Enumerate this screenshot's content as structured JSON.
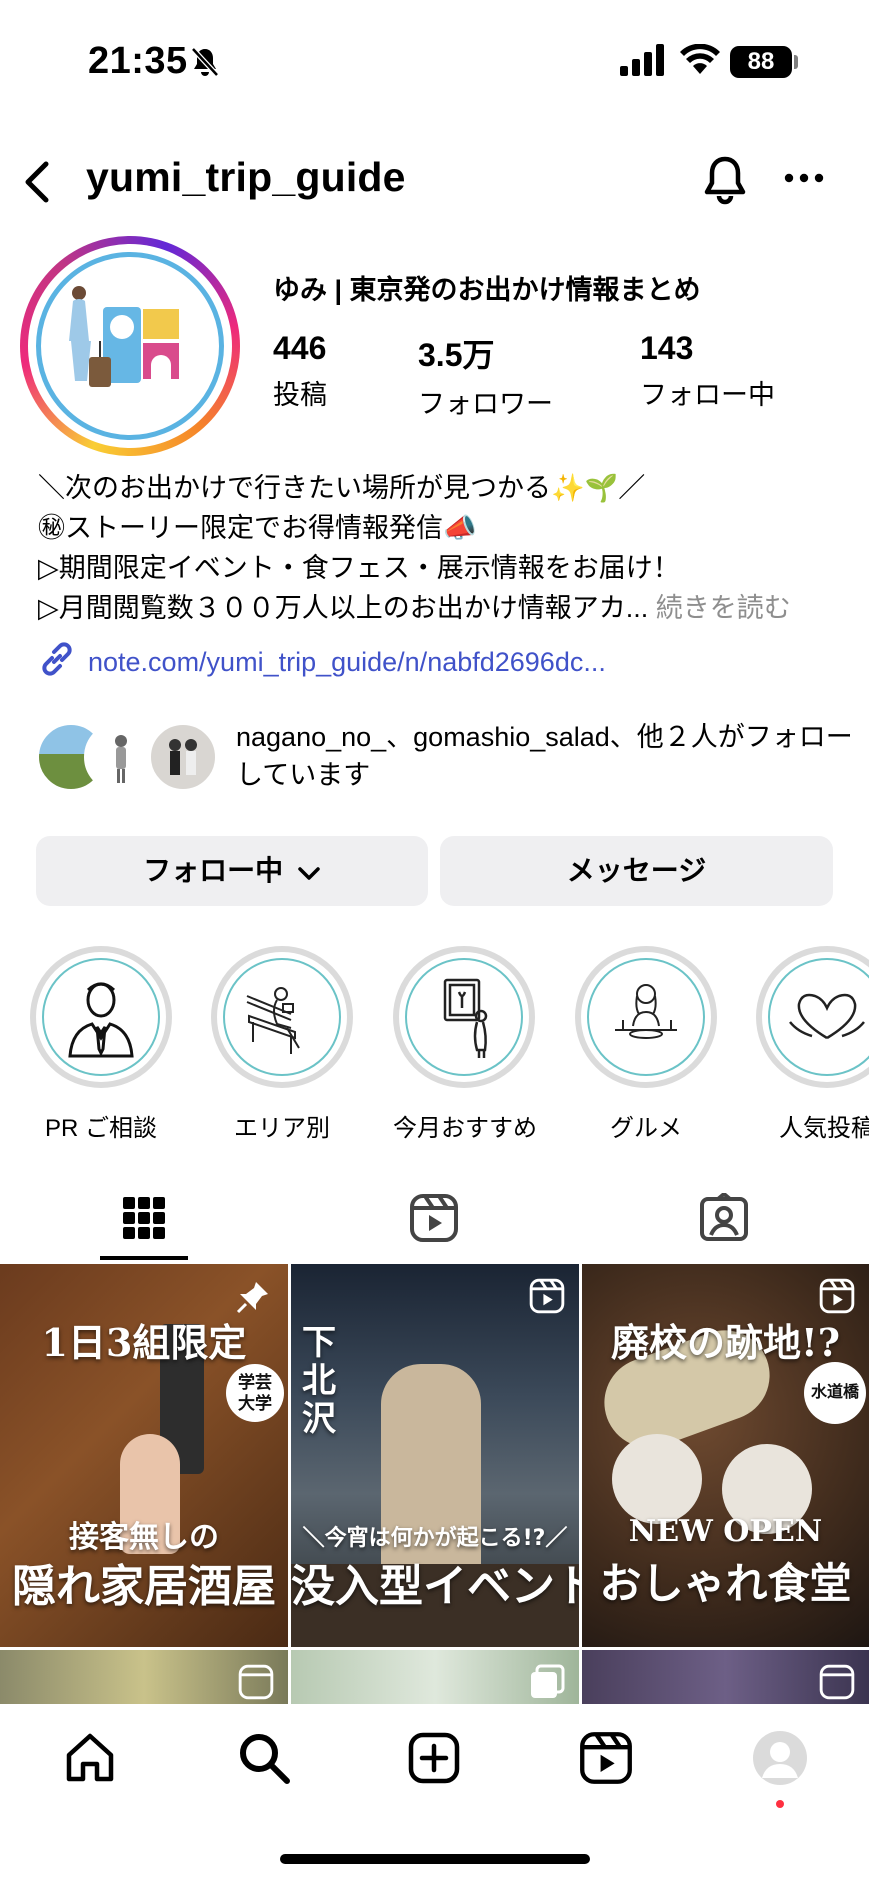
{
  "status": {
    "time": "21:35",
    "battery": "88"
  },
  "header": {
    "username": "yumi_trip_guide"
  },
  "profile": {
    "display_name": "ゆみ | 東京発のお出かけ情報まとめ",
    "stats": [
      {
        "value": "446",
        "label": "投稿"
      },
      {
        "value": "3.5万",
        "label": "フォロワー"
      },
      {
        "value": "143",
        "label": "フォロー中"
      }
    ],
    "bio_lines": [
      "＼次のお出かけで行きたい場所が見つかる✨🌱／",
      "㊙ストーリー限定でお得情報発信📣",
      "▷期間限定イベント・食フェス・展示情報をお届け！",
      "▷月間閲覧数３００万人以上のお出かけ情報アカ..."
    ],
    "bio_more": "続きを読む",
    "link": "note.com/yumi_trip_guide/n/nabfd2696dc...",
    "mutual_text": "nagano_no_、gomashio_salad、他２人がフォローしています"
  },
  "buttons": {
    "following": "フォロー中",
    "message": "メッセージ"
  },
  "highlights": [
    {
      "label": "PR ご相談",
      "icon": "businessman-icon"
    },
    {
      "label": "エリア別",
      "icon": "bench-reader-icon"
    },
    {
      "label": "今月おすすめ",
      "icon": "art-gallery-icon"
    },
    {
      "label": "グルメ",
      "icon": "dining-woman-icon"
    },
    {
      "label": "人気投稿",
      "icon": "heart-hands-icon"
    }
  ],
  "tabs": [
    "grid-icon",
    "reels-icon",
    "tagged-icon"
  ],
  "posts": [
    {
      "top": "1日3組限定",
      "badge": "学芸\n大学",
      "sub": "接客無しの",
      "main": "隠れ家居酒屋",
      "icon": "pin-icon"
    },
    {
      "top": "下\n北\n沢",
      "badge": "",
      "sub": "＼今宵は何かが起こる!?／",
      "main": "没入型イベント",
      "icon": "reels-icon"
    },
    {
      "top": "廃校の跡地!?",
      "badge": "水道橋",
      "sub": "NEW OPEN",
      "main": "おしゃれ食堂",
      "icon": "reels-icon"
    }
  ],
  "colors": {
    "accent_link": "#4052c9",
    "button_bg": "#efeff1",
    "notif_dot": "#ff3040"
  }
}
